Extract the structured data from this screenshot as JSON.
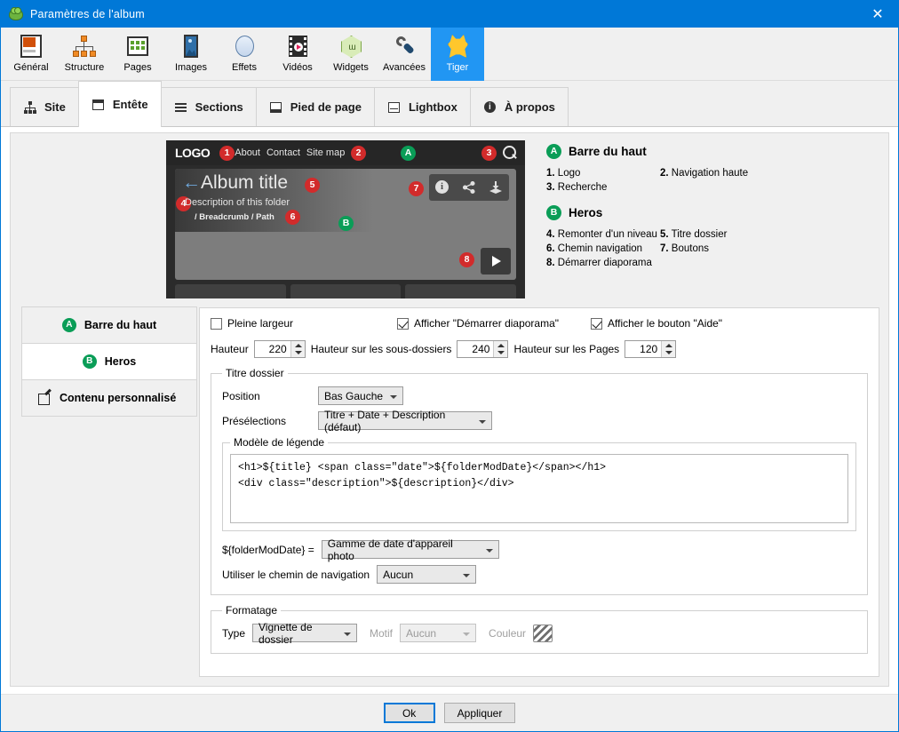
{
  "window": {
    "title": "Paramètres de l'album",
    "icon": "frog-icon",
    "close_label": "✕",
    "accent_color": "#0078d7"
  },
  "toolbar": {
    "items": [
      {
        "label": "Général",
        "icon": "general-icon",
        "active": false
      },
      {
        "label": "Structure",
        "icon": "structure-icon",
        "active": false
      },
      {
        "label": "Pages",
        "icon": "pages-icon",
        "active": false
      },
      {
        "label": "Images",
        "icon": "images-icon",
        "active": false
      },
      {
        "label": "Effets",
        "icon": "effects-icon",
        "active": false
      },
      {
        "label": "Vidéos",
        "icon": "videos-icon",
        "active": false
      },
      {
        "label": "Widgets",
        "icon": "widgets-icon",
        "active": false
      },
      {
        "label": "Avancées",
        "icon": "advanced-icon",
        "active": false
      },
      {
        "label": "Tiger",
        "icon": "tiger-icon",
        "active": true
      }
    ],
    "active_color": "#2196f3"
  },
  "tabs": [
    {
      "label": "Site",
      "icon": "sitemap-icon",
      "active": false
    },
    {
      "label": "Entête",
      "icon": "header-icon",
      "active": true
    },
    {
      "label": "Sections",
      "icon": "hamburger-icon",
      "active": false
    },
    {
      "label": "Pied de page",
      "icon": "footer-icon",
      "active": false
    },
    {
      "label": "Lightbox",
      "icon": "lightbox-icon",
      "active": false
    },
    {
      "label": "À propos",
      "icon": "info-icon",
      "active": false
    }
  ],
  "preview": {
    "logo": "LOGO",
    "nav_links": [
      "About",
      "Contact",
      "Site map"
    ],
    "title": "Album title",
    "back_arrow": "←",
    "description": "Description of this folder",
    "breadcrumb": "/ Breadcrumb / Path",
    "hero_buttons": [
      "info-icon",
      "share-icon",
      "download-icon"
    ],
    "play_button": "play-icon",
    "search": "search-icon",
    "badges": {
      "logo": "1",
      "nav": "2",
      "search": "3",
      "up_level": "4",
      "title": "5",
      "breadcrumb": "6",
      "buttons": "7",
      "slideshow": "8",
      "topbar": "A",
      "hero": "B"
    },
    "badge_color": "#d22b2b",
    "group_color": "#0a9d57"
  },
  "legend": {
    "groups": [
      {
        "key": "A",
        "title": "Barre du haut",
        "entries": [
          {
            "num": "1.",
            "label": "Logo"
          },
          {
            "num": "2.",
            "label": "Navigation haute"
          },
          {
            "num": "3.",
            "label": "Recherche"
          },
          {
            "num": "",
            "label": ""
          }
        ]
      },
      {
        "key": "B",
        "title": "Heros",
        "entries": [
          {
            "num": "4.",
            "label": "Remonter d'un niveau"
          },
          {
            "num": "5.",
            "label": "Titre dossier"
          },
          {
            "num": "6.",
            "label": "Chemin navigation"
          },
          {
            "num": "7.",
            "label": "Boutons"
          },
          {
            "num": "8.",
            "label": "Démarrer diaporama"
          },
          {
            "num": "",
            "label": ""
          }
        ]
      }
    ]
  },
  "sections": [
    {
      "key": "A",
      "label": "Barre du haut",
      "icon": "circle-a-icon",
      "active": false
    },
    {
      "key": "B",
      "label": "Heros",
      "icon": "circle-b-icon",
      "active": true
    },
    {
      "key": "",
      "label": "Contenu personnalisé",
      "icon": "pen-icon",
      "active": false
    }
  ],
  "settings": {
    "checkboxes": [
      {
        "label": "Pleine largeur",
        "checked": false
      },
      {
        "label": "Afficher \"Démarrer diaporama\"",
        "checked": true
      },
      {
        "label": "Afficher le bouton \"Aide\"",
        "checked": true
      }
    ],
    "heights": [
      {
        "label": "Hauteur",
        "value": "220"
      },
      {
        "label": "Hauteur sur les sous-dossiers",
        "value": "240"
      },
      {
        "label": "Hauteur sur les Pages",
        "value": "120"
      }
    ],
    "folder_title": {
      "group_label": "Titre dossier",
      "position_label": "Position",
      "position_value": "Bas Gauche",
      "presets_label": "Présélections",
      "presets_value": "Titre + Date + Description (défaut)",
      "template_group_label": "Modèle de légende",
      "template_value": "<h1>${title} <span class=\"date\">${folderModDate}</span></h1>\n<div class=\"description\">${description}</div>",
      "moddate_label": "${folderModDate} =",
      "moddate_value": "Gamme de date d'appareil photo",
      "navpath_label": "Utiliser le chemin de navigation",
      "navpath_value": "Aucun"
    },
    "formatting": {
      "group_label": "Formatage",
      "type_label": "Type",
      "type_value": "Vignette de dossier",
      "pattern_label": "Motif",
      "pattern_value": "Aucun",
      "pattern_disabled": true,
      "color_label": "Couleur",
      "color_swatch": "hatched-swatch"
    }
  },
  "footer": {
    "ok_label": "Ok",
    "apply_label": "Appliquer"
  }
}
